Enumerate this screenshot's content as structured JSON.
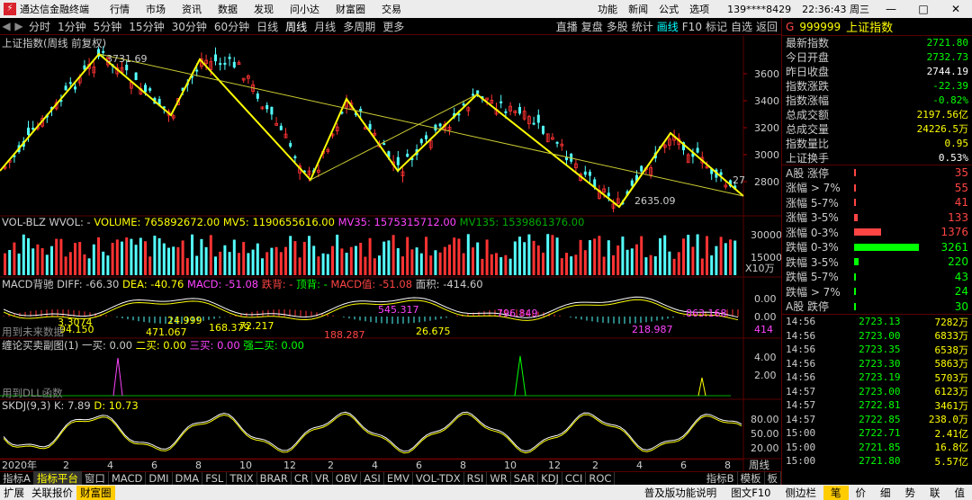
{
  "titlebar": {
    "app": "通达信金融终端",
    "menus": [
      "行情",
      "市场",
      "资讯",
      "数据",
      "发现",
      "问小达",
      "财富圈",
      "交易"
    ],
    "right": [
      "功能",
      "新闻",
      "公式",
      "选项"
    ],
    "user": "139****8429",
    "clock": "22:36:43 周三"
  },
  "toolbar": {
    "periods": [
      "分时",
      "1分钟",
      "5分钟",
      "15分钟",
      "30分钟",
      "60分钟",
      "日线",
      "周线",
      "月线",
      "多周期",
      "更多"
    ],
    "active": "周线",
    "tools": [
      "直播",
      "复盘",
      "多股",
      "统计",
      "画线",
      "F10",
      "标记",
      "自选",
      "返回"
    ]
  },
  "main": {
    "title": "上证指数(周线 前复权)",
    "high_label": "3731.69",
    "low_label": "2635.09",
    "cut_label": "27",
    "yticks": [
      "3600.00",
      "3400.00",
      "3200.00",
      "3000.00",
      "2800.00"
    ]
  },
  "vol": {
    "name": "VOL-BLZ",
    "wvol": "WVOL: -",
    "volume": "VOLUME: 765892672.00",
    "mv5": "MV5: 1190655616.00",
    "mv35": "MV35: 1575315712.00",
    "mv135": "MV135: 1539861376.00",
    "yticks": [
      "30000",
      "15000",
      "X10万"
    ]
  },
  "macd": {
    "name": "MACD背驰",
    "diff": "DIFF: -66.30",
    "dea": "DEA: -40.76",
    "macd": "MACD: -51.08",
    "a": "跌背: -",
    "b": "顶背: -",
    "c": "MACD值: -51.08",
    "area": "面积: -414.60",
    "yticks": [
      "0.00",
      "0.00",
      "414"
    ],
    "labels": [
      "545.317",
      "796.849",
      "863.168",
      "471.067",
      "168.379",
      "72.217",
      "26.675",
      "218.987",
      "3.3074",
      "94.150",
      "24.999",
      "188.287"
    ],
    "note": "用到未来数据"
  },
  "chan": {
    "name": "缠论买卖副图(1)",
    "b1": "一买: 0.00",
    "b2": "二买: 0.00",
    "b3": "三买: 0.00",
    "b4": "强二买: 0.00",
    "yticks": [
      "4.00",
      "2.00"
    ],
    "note": "用到DLL函数"
  },
  "skdj": {
    "name": "SKDJ(9,3)",
    "k": "K: 7.89",
    "d": "D: 10.73",
    "yticks": [
      "80.00",
      "50.00",
      "20.00"
    ],
    "period_label": "周线"
  },
  "axis": {
    "year": "2020年",
    "months": [
      "2",
      "4",
      "6",
      "8",
      "10",
      "12",
      "2",
      "4",
      "6",
      "8",
      "10",
      "12",
      "2",
      "4",
      "6",
      "8"
    ]
  },
  "quote": {
    "flag": "G",
    "code": "999999",
    "name": "上证指数",
    "stats": [
      {
        "label": "最新指数",
        "value": "2721.80",
        "color": "#00ff00"
      },
      {
        "label": "今日开盘",
        "value": "2732.73",
        "color": "#00ff00"
      },
      {
        "label": "昨日收盘",
        "value": "2744.19",
        "color": "#ffffff"
      },
      {
        "label": "指数涨跌",
        "value": "-22.39",
        "color": "#00ff00"
      },
      {
        "label": "指数涨幅",
        "value": "-0.82%",
        "color": "#00ff00"
      },
      {
        "label": "总成交额",
        "value": "2197.56亿",
        "color": "#ffff00"
      },
      {
        "label": "总成交量",
        "value": "24226.5万",
        "color": "#ffff00"
      },
      {
        "label": "指数量比",
        "value": "0.95",
        "color": "#ffff00"
      },
      {
        "label": "上证换手",
        "value": "0.53%",
        "color": "#ffffff"
      }
    ],
    "dist": [
      {
        "label": "A股 涨停",
        "value": "35",
        "color": "#ff4444",
        "frac": 0.02
      },
      {
        "label": "涨幅 > 7%",
        "value": "55",
        "color": "#ff4444",
        "frac": 0.03
      },
      {
        "label": "涨幅 5-7%",
        "value": "41",
        "color": "#ff4444",
        "frac": 0.02
      },
      {
        "label": "涨幅 3-5%",
        "value": "133",
        "color": "#ff4444",
        "frac": 0.05
      },
      {
        "label": "涨幅 0-3%",
        "value": "1376",
        "color": "#ff4444",
        "frac": 0.42
      },
      {
        "label": "跌幅 0-3%",
        "value": "3261",
        "color": "#00ff00",
        "frac": 1.0
      },
      {
        "label": "跌幅 3-5%",
        "value": "220",
        "color": "#00ff00",
        "frac": 0.07
      },
      {
        "label": "跌幅 5-7%",
        "value": "43",
        "color": "#00ff00",
        "frac": 0.02
      },
      {
        "label": "跌幅 > 7%",
        "value": "24",
        "color": "#00ff00",
        "frac": 0.01
      },
      {
        "label": "A股 跌停",
        "value": "30",
        "color": "#00ff00",
        "frac": 0.01
      }
    ],
    "trades": [
      {
        "t": "14:56",
        "p": "2723.13",
        "q": "7282万"
      },
      {
        "t": "14:56",
        "p": "2723.00",
        "q": "6833万"
      },
      {
        "t": "14:56",
        "p": "2723.35",
        "q": "6538万"
      },
      {
        "t": "14:56",
        "p": "2723.30",
        "q": "5863万"
      },
      {
        "t": "14:56",
        "p": "2723.19",
        "q": "5703万"
      },
      {
        "t": "14:57",
        "p": "2723.00",
        "q": "6123万"
      },
      {
        "t": "14:57",
        "p": "2722.81",
        "q": "3461万"
      },
      {
        "t": "14:57",
        "p": "2722.85",
        "q": "238.0万"
      },
      {
        "t": "15:00",
        "p": "2722.71",
        "q": "2.41亿"
      },
      {
        "t": "15:00",
        "p": "2721.85",
        "q": "16.8亿"
      },
      {
        "t": "15:00",
        "p": "2721.80",
        "q": "5.57亿"
      }
    ]
  },
  "indtabs": [
    "指标A",
    "指标平台",
    "窗口",
    "MACD",
    "DMI",
    "DMA",
    "FSL",
    "TRIX",
    "BRAR",
    "CR",
    "VR",
    "OBV",
    "ASI",
    "EMV",
    "VOL-TDX",
    "RSI",
    "WR",
    "SAR",
    "KDJ",
    "CCI",
    "ROC",
    "指标B",
    "模板",
    "板"
  ],
  "statusbar": {
    "items": [
      "扩展",
      "关联报价",
      "财富圈"
    ],
    "right": [
      "普及版功能说明",
      "图文F10",
      "侧边栏",
      "笔",
      "价",
      "细",
      "势",
      "联",
      "值"
    ]
  },
  "colors": {
    "up": "#ff3333",
    "down": "#54ffff",
    "trend": "#ffff00",
    "ma": "#cccc33"
  }
}
